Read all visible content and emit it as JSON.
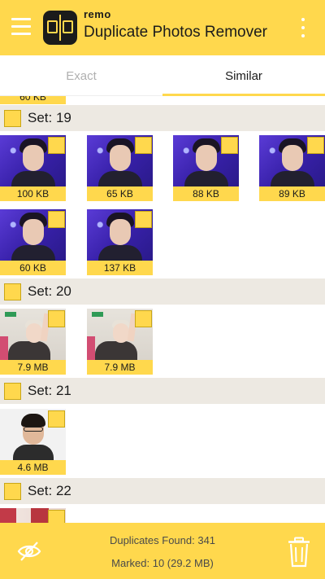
{
  "appbar": {
    "brand": "remo",
    "title": "Duplicate Photos Remover"
  },
  "tabs": [
    {
      "label": "Exact",
      "active": false
    },
    {
      "label": "Similar",
      "active": true
    }
  ],
  "top_partial_size": "60 KB",
  "sets": [
    {
      "label": "Set: 19",
      "items": [
        {
          "size": "100 KB",
          "image": "purple-portrait"
        },
        {
          "size": "65 KB",
          "image": "purple-portrait"
        },
        {
          "size": "88 KB",
          "image": "purple-portrait"
        },
        {
          "size": "89 KB",
          "image": "purple-portrait"
        },
        {
          "size": "60 KB",
          "image": "purple-portrait"
        },
        {
          "size": "137 KB",
          "image": "purple-portrait"
        }
      ]
    },
    {
      "label": "Set: 20",
      "items": [
        {
          "size": "7.9 MB",
          "image": "room-group-photo"
        },
        {
          "size": "7.9 MB",
          "image": "room-group-photo"
        }
      ]
    },
    {
      "label": "Set: 21",
      "items": [
        {
          "size": "4.6 MB",
          "image": "selfie-glasses"
        }
      ]
    },
    {
      "label": "Set: 22",
      "items": [
        {
          "size": "",
          "image": "partial-red"
        }
      ]
    }
  ],
  "footer": {
    "duplicates_found": "Duplicates Found: 341",
    "marked": "Marked: 10 (29.2 MB)"
  },
  "icons": {
    "menu": "hamburger-menu-icon",
    "overflow": "kebab-menu-icon",
    "hide": "eye-off-icon",
    "delete": "trash-icon"
  },
  "colors": {
    "accent": "#ffd84d",
    "set_header_bg": "#ede9e2",
    "text_dark": "#1b1b1b",
    "tab_inactive": "#b0b0b0"
  }
}
